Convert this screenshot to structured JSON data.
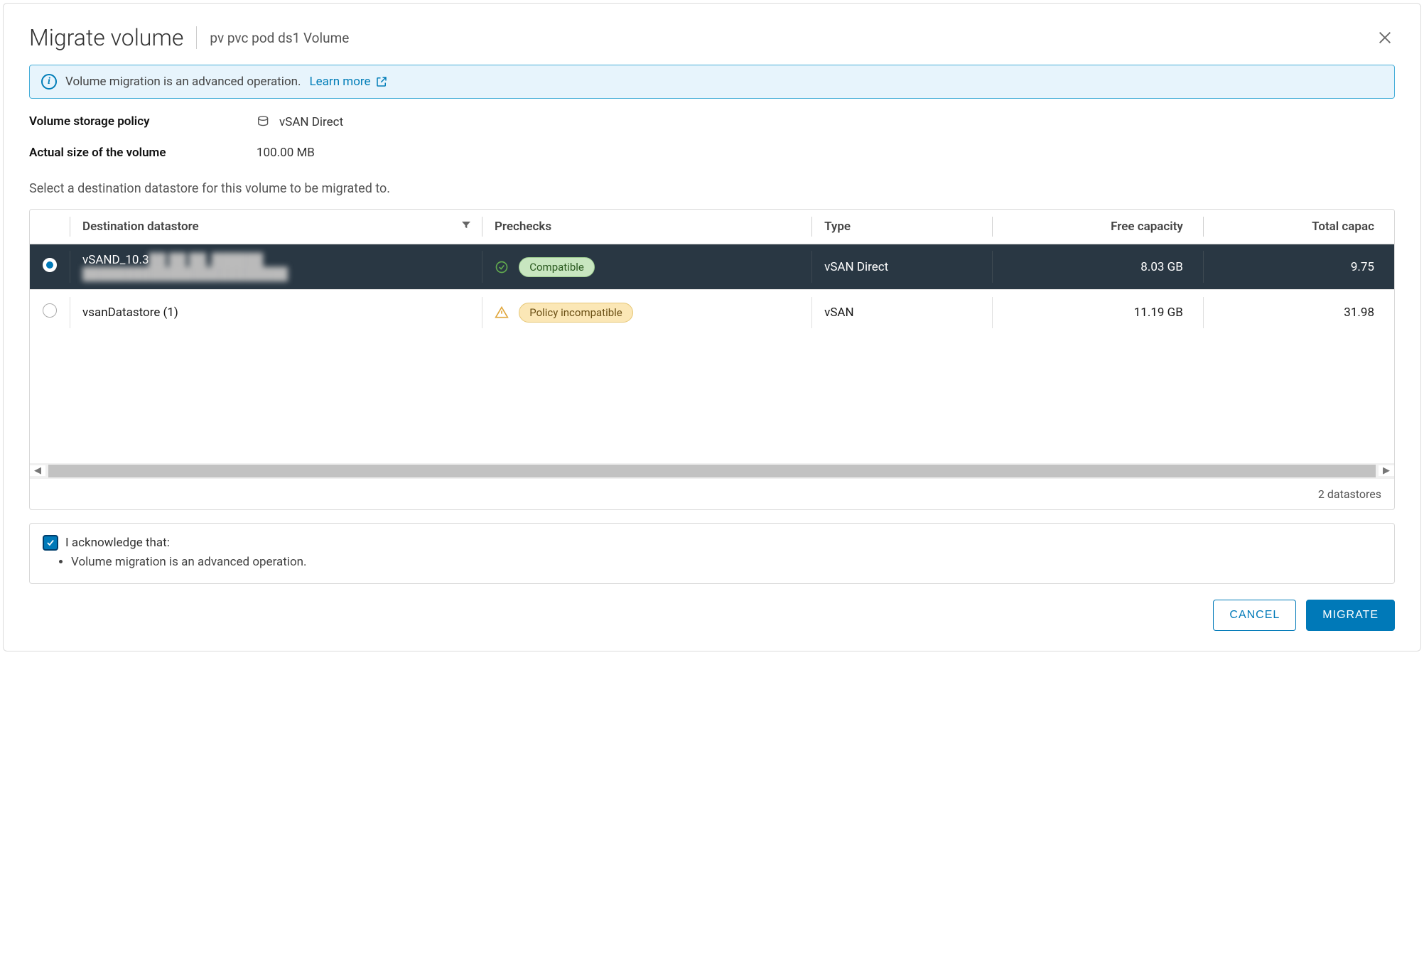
{
  "dialog": {
    "title": "Migrate volume",
    "subtitle": "pv pvc pod ds1 Volume",
    "banner": {
      "text": "Volume migration is an advanced operation.",
      "learn_more": "Learn more"
    },
    "meta": {
      "storage_policy_label": "Volume storage policy",
      "storage_policy_value": "vSAN Direct",
      "actual_size_label": "Actual size of the volume",
      "actual_size_value": "100.00 MB"
    },
    "instruction": "Select a destination datastore for this volume to be migrated to.",
    "table": {
      "columns": {
        "destination": "Destination datastore",
        "prechecks": "Prechecks",
        "type": "Type",
        "free_capacity": "Free capacity",
        "total_capacity": "Total capac"
      },
      "rows": [
        {
          "selected": true,
          "name_prefix": "vSAND_10.3",
          "name_rest": "██ ██ ██_██████ ████████████████████████",
          "precheck_label": "Compatible",
          "precheck_state": "ok",
          "type": "vSAN Direct",
          "free": "8.03 GB",
          "total": "9.75 "
        },
        {
          "selected": false,
          "name_prefix": "vsanDatastore (1)",
          "name_rest": "",
          "precheck_label": "Policy incompatible",
          "precheck_state": "warn",
          "type": "vSAN",
          "free": "11.19 GB",
          "total": "31.98 "
        }
      ],
      "footer": "2 datastores"
    },
    "acknowledge": {
      "heading": "I acknowledge that:",
      "items": [
        "Volume migration is an advanced operation."
      ]
    },
    "buttons": {
      "cancel": "CANCEL",
      "migrate": "MIGRATE"
    }
  }
}
